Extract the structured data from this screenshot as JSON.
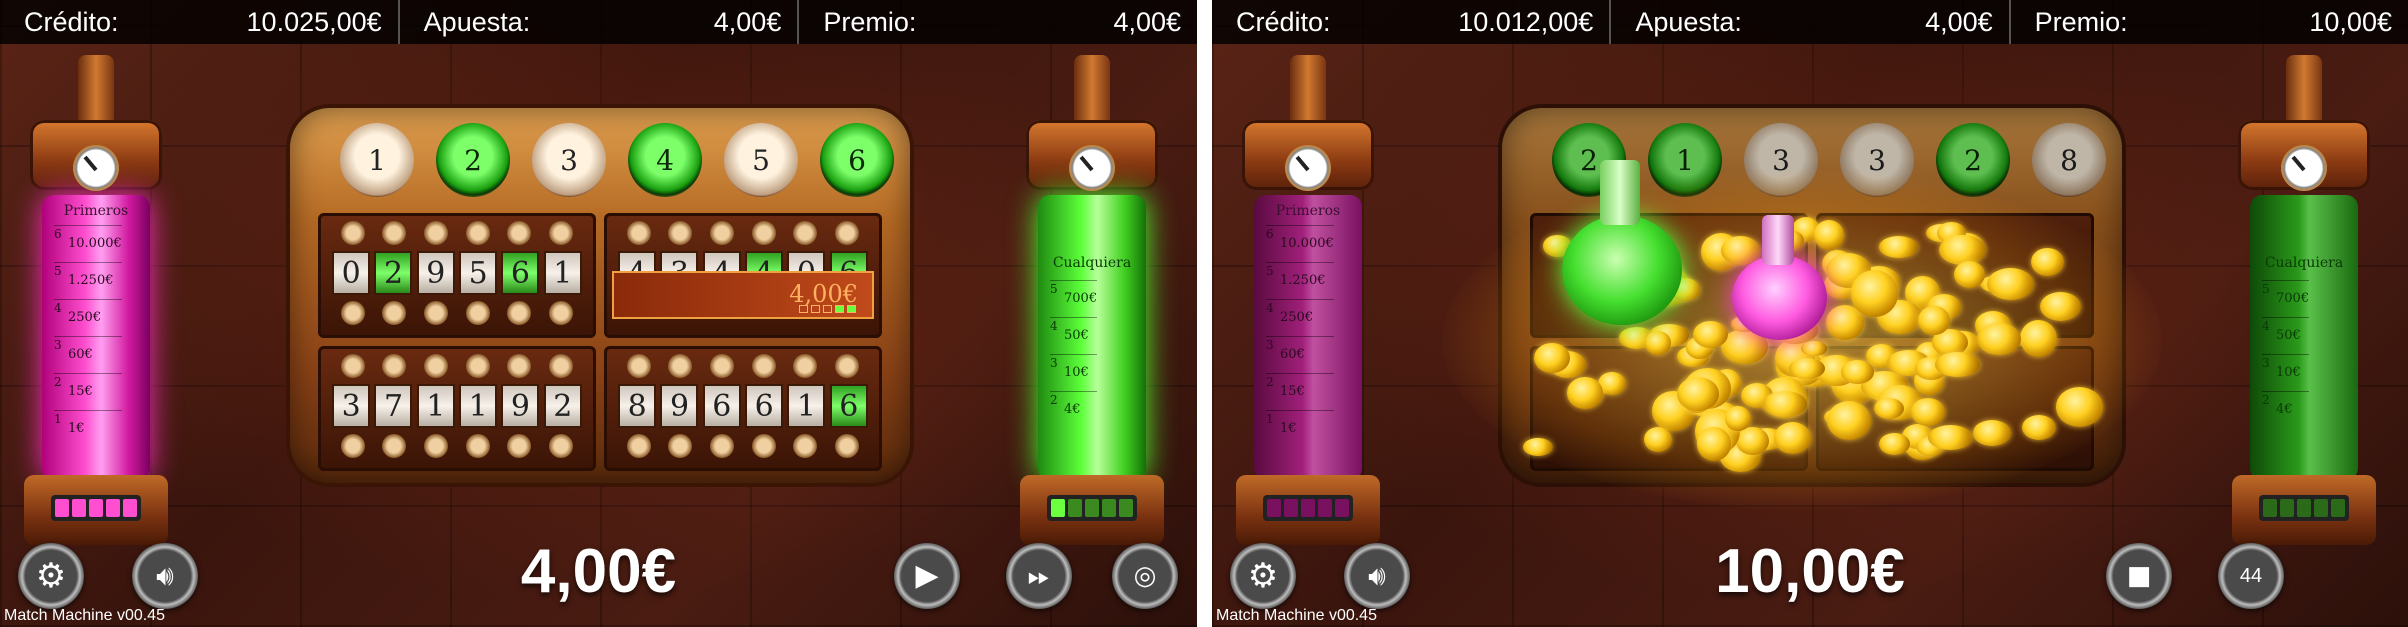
{
  "left": {
    "topbar": {
      "credit_label": "Crédito:",
      "credit_value": "10.025,00€",
      "bet_label": "Apuesta:",
      "bet_value": "4,00€",
      "prize_label": "Premio:",
      "prize_value": "4,00€"
    },
    "balls": [
      {
        "value": "1",
        "lit": false
      },
      {
        "value": "2",
        "lit": true
      },
      {
        "value": "3",
        "lit": false
      },
      {
        "value": "4",
        "lit": true
      },
      {
        "value": "5",
        "lit": false
      },
      {
        "value": "6",
        "lit": true
      }
    ],
    "cards": [
      {
        "digits": [
          "0",
          "2",
          "9",
          "5",
          "6",
          "1"
        ],
        "hits": [
          1,
          4
        ]
      },
      {
        "digits": [
          "4",
          "3",
          "4",
          "4",
          "0",
          "6"
        ],
        "hits": [
          3,
          5
        ],
        "win": "4,00€"
      },
      {
        "digits": [
          "3",
          "7",
          "1",
          "1",
          "9",
          "2"
        ],
        "hits": []
      },
      {
        "digits": [
          "8",
          "9",
          "6",
          "6",
          "1",
          "6"
        ],
        "hits": [
          5
        ]
      }
    ],
    "big_win": "4,00€",
    "controls": [
      "settings-icon",
      "sound-icon",
      "play-icon",
      "fast-forward-icon",
      "coins-icon"
    ]
  },
  "right": {
    "topbar": {
      "credit_label": "Crédito:",
      "credit_value": "10.012,00€",
      "bet_label": "Apuesta:",
      "bet_value": "4,00€",
      "prize_label": "Premio:",
      "prize_value": "10,00€"
    },
    "balls": [
      {
        "value": "2",
        "lit": true
      },
      {
        "value": "1",
        "lit": true
      },
      {
        "value": "3",
        "lit": false
      },
      {
        "value": "3",
        "lit": false
      },
      {
        "value": "2",
        "lit": true
      },
      {
        "value": "8",
        "lit": false
      }
    ],
    "big_win": "10,00€",
    "autoplay_count": "44",
    "controls": [
      "settings-icon",
      "sound-icon",
      "stop-icon",
      "autoplay-icon"
    ]
  },
  "pink_tube": {
    "title": "Primeros",
    "levels": [
      "10.000€",
      "1.250€",
      "250€",
      "60€",
      "15€",
      "1€"
    ],
    "steps": [
      "6",
      "5",
      "4",
      "3",
      "2",
      "1"
    ]
  },
  "green_tube": {
    "title": "Cualquiera",
    "levels": [
      "700€",
      "50€",
      "10€",
      "4€"
    ],
    "steps": [
      "5",
      "4",
      "3",
      "2"
    ]
  },
  "version": "Match Machine v00.45",
  "colors": {
    "lit_green": "#46e030",
    "pink": "#ff4fd0",
    "gold": "#ffd020"
  }
}
